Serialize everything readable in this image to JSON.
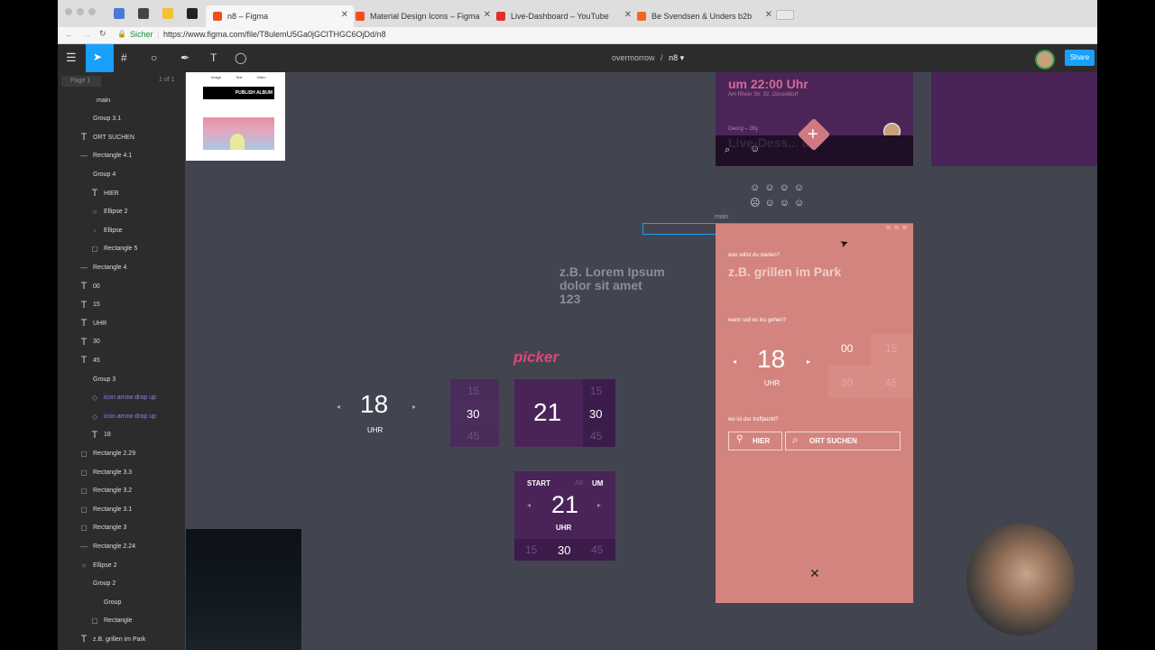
{
  "browser": {
    "tabs": [
      {
        "title": "n8 – Figma"
      },
      {
        "title": "Material Design Icons – Figma"
      },
      {
        "title": "Live-Dashboard – YouTube"
      },
      {
        "title": "Be Svendsen & Unders b2b"
      }
    ],
    "secure_label": "Sicher",
    "url": "https://www.figma.com/file/T8ulemU5Ga0jGCITHGC6OjDd/n8"
  },
  "figma": {
    "project": "overmorrow",
    "file": "n8",
    "share_label": "Share",
    "page_label": "Page 1",
    "page_count": "1 of 1",
    "layers": [
      {
        "name": "main",
        "icon": "frame",
        "indent": 0
      },
      {
        "name": "Group 3.1",
        "icon": "none",
        "indent": 1
      },
      {
        "name": "ORT SUCHEN",
        "icon": "T",
        "indent": 1
      },
      {
        "name": "Rectangle 4.1",
        "icon": "line",
        "indent": 1
      },
      {
        "name": "Group 4",
        "icon": "none",
        "indent": 1
      },
      {
        "name": "HIER",
        "icon": "T",
        "indent": 2
      },
      {
        "name": "Ellipse 2",
        "icon": "circle",
        "indent": 2
      },
      {
        "name": "Ellipse",
        "icon": "pin",
        "indent": 2
      },
      {
        "name": "Rectangle 5",
        "icon": "rect",
        "indent": 2
      },
      {
        "name": "Rectangle 4",
        "icon": "line",
        "indent": 1
      },
      {
        "name": "00",
        "icon": "T",
        "indent": 1
      },
      {
        "name": "15",
        "icon": "T",
        "indent": 1
      },
      {
        "name": "UHR",
        "icon": "T",
        "indent": 1
      },
      {
        "name": "30",
        "icon": "T",
        "indent": 1
      },
      {
        "name": "45",
        "icon": "T",
        "indent": 1
      },
      {
        "name": "Group 3",
        "icon": "none",
        "indent": 1
      },
      {
        "name": "icon arrow drop up",
        "icon": "diamond",
        "indent": 2,
        "component": true
      },
      {
        "name": "icon arrow drop up",
        "icon": "diamond",
        "indent": 2,
        "component": true
      },
      {
        "name": "18",
        "icon": "T",
        "indent": 2
      },
      {
        "name": "Rectangle 2.29",
        "icon": "rect",
        "indent": 1
      },
      {
        "name": "Rectangle 3.3",
        "icon": "rect",
        "indent": 1
      },
      {
        "name": "Rectangle 3.2",
        "icon": "rect",
        "indent": 1
      },
      {
        "name": "Rectangle 3.1",
        "icon": "rect",
        "indent": 1
      },
      {
        "name": "Rectangle 3",
        "icon": "rect",
        "indent": 1
      },
      {
        "name": "Rectangle 2.24",
        "icon": "line",
        "indent": 1
      },
      {
        "name": "Ellipse 2",
        "icon": "circle",
        "indent": 1
      },
      {
        "name": "Group 2",
        "icon": "none",
        "indent": 1
      },
      {
        "name": "Group",
        "icon": "none",
        "indent": 2
      },
      {
        "name": "Rectangle",
        "icon": "rect",
        "indent": 2
      },
      {
        "name": "z.B. grillen im Park",
        "icon": "T",
        "indent": 1
      }
    ]
  },
  "canvas": {
    "thumb": {
      "nav": [
        "Image",
        "Text",
        "Video"
      ],
      "button": "PUBLISH ALBUM"
    },
    "top_card": {
      "headline": "um 22:00 Uhr",
      "address": "Am Rhein Str. 92, Düsseldorf",
      "person": "Georg – 28y",
      "ghost_text": "Live-Dess... am"
    },
    "placeholder_text": "z.B. Lorem Ipsum\ndolor sit amet\n123",
    "picker_label": "picker",
    "picker1": {
      "hour": "18",
      "unit": "UHR"
    },
    "minutes_col": {
      "top": "15",
      "mid": "30",
      "bot": "45"
    },
    "picker2": {
      "hour": "21",
      "top": "15",
      "mid": "30",
      "bot": "45"
    },
    "picker3": {
      "start": "START",
      "ab": "AB",
      "um": "UM",
      "hour": "21",
      "unit": "UHR",
      "m1": "15",
      "m2": "30",
      "m3": "45"
    },
    "frame_label": "main",
    "main": {
      "q1": "was willst du starten?",
      "input1": "z.B. grillen im Park",
      "q2": "wann soll es los gehen?",
      "hour": "18",
      "unit": "UHR",
      "min00": "00",
      "min15": "15",
      "min30": "30",
      "min45": "45",
      "q3": "wo ist der treffpunkt?",
      "here": "HIER",
      "search": "ORT SUCHEN"
    }
  },
  "colors": {
    "canvas": "#424550",
    "figma_blue": "#18a0fb",
    "picker_pink": "#e0457b",
    "main_salmon": "#d4847e",
    "purple": "#4a2458"
  }
}
